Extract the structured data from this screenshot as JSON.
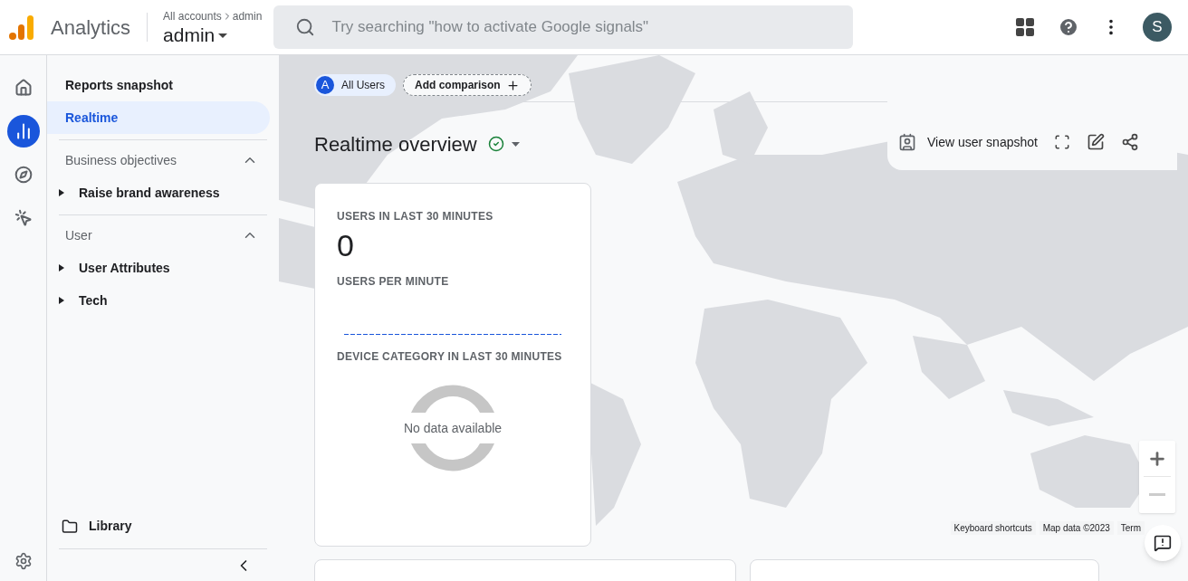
{
  "header": {
    "product": "Analytics",
    "breadcrumb_root": "All accounts",
    "breadcrumb_leaf": "admin",
    "account": "admin",
    "search": {
      "placeholder": "Try searching \"how to activate Google signals\""
    },
    "avatar": "S"
  },
  "rail": [
    {
      "kind": "home",
      "selected": false
    },
    {
      "kind": "reports",
      "selected": true
    },
    {
      "kind": "explore",
      "selected": false
    },
    {
      "kind": "advertising",
      "selected": false
    }
  ],
  "nav": {
    "items": [
      {
        "label": "Reports snapshot",
        "selected": false
      },
      {
        "label": "Realtime",
        "selected": true
      }
    ],
    "sections": [
      {
        "title": "Business objectives",
        "expanded": true,
        "children": [
          {
            "label": "Raise brand awareness",
            "expanded": false
          }
        ]
      },
      {
        "title": "User",
        "expanded": true,
        "children": [
          {
            "label": "User Attributes",
            "expanded": false
          },
          {
            "label": "Tech",
            "expanded": false
          }
        ]
      }
    ],
    "library": "Library"
  },
  "comparison": {
    "badge": "A",
    "segment": "All Users",
    "add": "Add comparison"
  },
  "title": "Realtime overview",
  "actions": {
    "snapshot": "View user snapshot"
  },
  "card": {
    "users_label": "USERS IN LAST 30 MINUTES",
    "users_value": "0",
    "per_minute_label": "USERS PER MINUTE",
    "device_label": "DEVICE CATEGORY IN LAST 30 MINUTES",
    "donut_text": "No data available"
  },
  "map_footer": [
    "Keyboard shortcuts",
    "Map data ©2023",
    "Term"
  ]
}
